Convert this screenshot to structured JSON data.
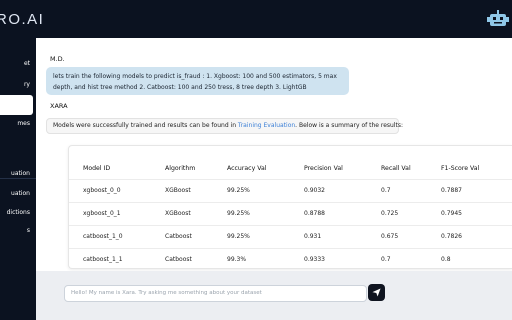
{
  "app": {
    "brand": "RO.AI"
  },
  "sidebar": {
    "items": [
      {
        "label": "et",
        "active": false
      },
      {
        "label": "ry",
        "active": false
      },
      {
        "label": "",
        "active": true
      },
      {
        "label": "mes",
        "active": false
      },
      {
        "label": "uation",
        "active": false
      },
      {
        "label": "uation",
        "active": false
      },
      {
        "label": "dictions",
        "active": false
      },
      {
        "label": "s",
        "active": false
      }
    ]
  },
  "chat": {
    "user_name": "M.D.",
    "user_message": "lets train the following models to predict is_fraud : 1. Xgboost: 100 and 500 estimators, 5 max depth, and hist tree method 2. Catboost: 100 and 250 tress, 8 tree depth 3. LightGB",
    "bot_name": "XARA",
    "bot_message_prefix": "Models were successfully trained and results can be found in ",
    "bot_message_link": "Training Evaluation",
    "bot_message_suffix": ". Below is a summary of the results:"
  },
  "results_table": {
    "columns": [
      "Model ID",
      "Algorithm",
      "Accuracy Val",
      "Precision Val",
      "Recall Val",
      "F1-Score Val"
    ],
    "rows": [
      [
        "xgboost_0_0",
        "XGBoost",
        "99.25%",
        "0.9032",
        "0.7",
        "0.7887"
      ],
      [
        "xgboost_0_1",
        "XGBoost",
        "99.25%",
        "0.8788",
        "0.725",
        "0.7945"
      ],
      [
        "catboost_1_0",
        "Catboost",
        "99.25%",
        "0.931",
        "0.675",
        "0.7826"
      ],
      [
        "catboost_1_1",
        "Catboost",
        "99.3%",
        "0.9333",
        "0.7",
        "0.8"
      ]
    ]
  },
  "composer": {
    "placeholder": "Hello! My name is Xara. Try asking me something about your dataset"
  },
  "colors": {
    "sidebar_bg": "#0b1220",
    "user_bubble": "#cfe3f0",
    "link": "#3b7fd6"
  }
}
